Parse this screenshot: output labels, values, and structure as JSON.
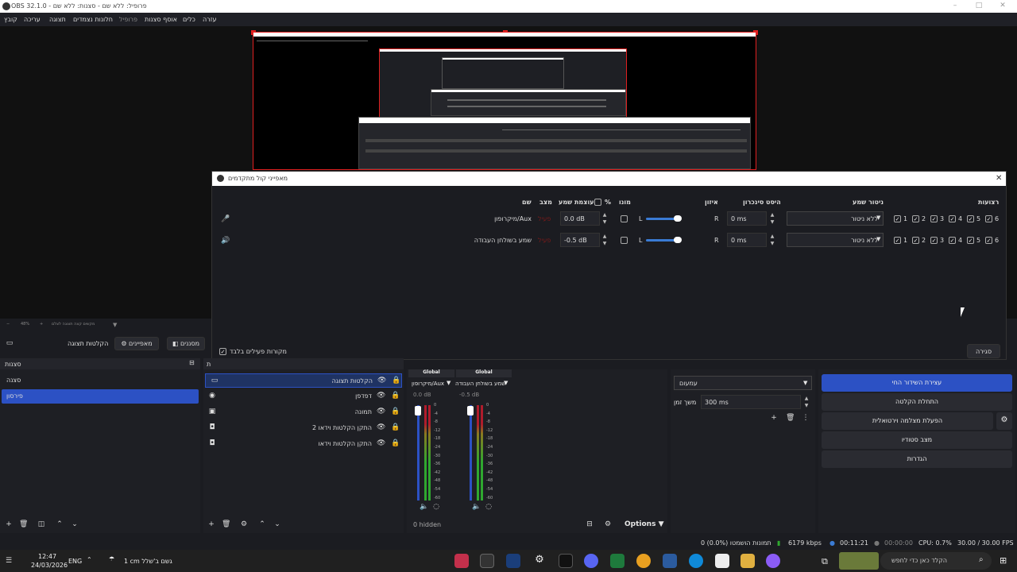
{
  "window": {
    "title": "OBS 32.1.0 - פרופיל: ללא שם - סצנות: ללא שם"
  },
  "menu": {
    "items": [
      "קובץ",
      "עריכה",
      "תצוגה",
      "חלונות נצמדים",
      "פרופיל",
      "אוסף סצנות",
      "כלים",
      "עזרה"
    ]
  },
  "preview": {
    "zoom": "48%",
    "zoom_hint": "מקשים קצה תצוגה לצלם"
  },
  "mixer": {
    "title": "מאפייני קול מתקדמים",
    "headers": {
      "name": "שם",
      "status": "מצב",
      "volume": "עוצמת שמע",
      "percent": "%",
      "mono": "מונו",
      "balance": "איזון",
      "sync": "היסט סינכרון",
      "monitor": "ניטור שמע",
      "tracks": "רצועות"
    },
    "rows": [
      {
        "name": "מיקרופון/Aux",
        "status": "פעיל",
        "volume": "0.0 dB",
        "balance_left": "L",
        "balance_right": "R",
        "sync": "0 ms",
        "monitor": "ללא ניטור",
        "tracks": [
          "1",
          "2",
          "3",
          "4",
          "5",
          "6"
        ]
      },
      {
        "name": "שמע בשולחן העבודה",
        "status": "פעיל",
        "volume": "-0.5 dB",
        "balance_left": "L",
        "balance_right": "R",
        "sync": "0 ms",
        "monitor": "ללא ניטור",
        "tracks": [
          "1",
          "2",
          "3",
          "4",
          "5",
          "6"
        ]
      }
    ],
    "active_only": "מקורות פעילים בלבד",
    "close": "סגירה"
  },
  "docktabs": {
    "transitions": "מסננים",
    "properties": "מאפיינים",
    "scene_preview": "הקלטות תצוגה"
  },
  "scenes": {
    "title": "סצנות",
    "items": [
      "סצנה",
      "פירסון"
    ],
    "selected": 1
  },
  "sources": {
    "title": "מקורות",
    "items": [
      "הקלטות תצוגה",
      "דפדפן",
      "תמונה",
      "התקן הקלטות וידאו 2",
      "התקן הקלטות וידאו"
    ]
  },
  "audio": {
    "channels": [
      {
        "name": "מיקרופון/Aux",
        "tag": "Global",
        "db": "0.0 dB"
      },
      {
        "name": "שמע בשולחן העבודה",
        "tag": "Global",
        "db": "-0.5 dB"
      }
    ],
    "scale": [
      "0",
      "-4",
      "-8",
      "-12",
      "-18",
      "-24",
      "-30",
      "-36",
      "-42",
      "-48",
      "-54",
      "-60"
    ],
    "hidden": "0 hidden",
    "options": "Options"
  },
  "transition": {
    "type": "עמעום",
    "duration_label": "משך זמן",
    "duration": "300 ms"
  },
  "controls": {
    "stream": "עצירת השידור החי",
    "record": "התחלת הקלטה",
    "virtualcam": "הפעלת מצלמה וירטואלית",
    "studio": "מצב סטודיו",
    "settings": "הגדרות"
  },
  "status": {
    "dropped": "0 תמונות הושמטו (0.0%)",
    "bitrate": "6179 kbps",
    "live_time": "00:11:21",
    "rec_time": "00:00:00",
    "cpu": "CPU: 0.7%",
    "fps": "30.00 / 30.00 FPS"
  },
  "taskbar": {
    "time": "12:47",
    "date": "24/03/2026",
    "lang": "ENG",
    "weather": "1 cm גשם ב'שלל",
    "search": "הקלד כאן כדי לחפש"
  },
  "colors": {
    "accent": "#2c51c4",
    "live": "#e02020",
    "meter_green": "#2fa82f",
    "meter_red": "#b01c2c"
  }
}
